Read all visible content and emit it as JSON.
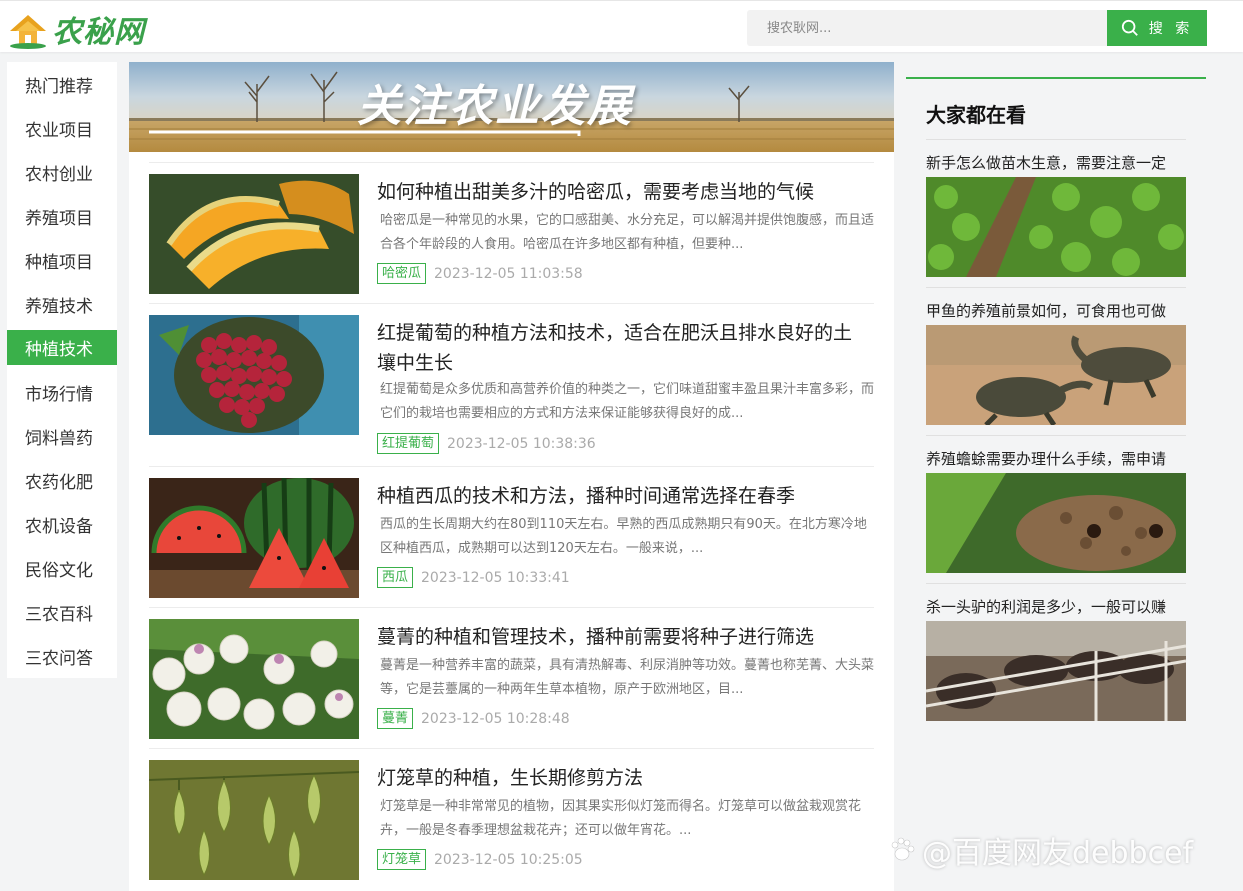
{
  "header": {
    "logo_text": "农秘网",
    "search_placeholder": "搜农耿网...",
    "search_button": "搜 索"
  },
  "sidebar": {
    "items": [
      {
        "label": "热门推荐"
      },
      {
        "label": "农业项目"
      },
      {
        "label": "农村创业"
      },
      {
        "label": "养殖项目"
      },
      {
        "label": "种植项目"
      },
      {
        "label": "养殖技术"
      },
      {
        "label": "种植技术",
        "active": true
      },
      {
        "label": "市场行情"
      },
      {
        "label": "饲料兽药"
      },
      {
        "label": "农药化肥"
      },
      {
        "label": "农机设备"
      },
      {
        "label": "民俗文化"
      },
      {
        "label": "三农百科"
      },
      {
        "label": "三农问答"
      }
    ]
  },
  "banner": {
    "title": "关注农业发展"
  },
  "articles": [
    {
      "title": "如何种植出甜美多汁的哈密瓜，需要考虑当地的气候",
      "desc": "哈密瓜是一种常见的水果，它的口感甜美、水分充足，可以解渴并提供饱腹感，而且适合各个年龄段的人食用。哈密瓜在许多地区都有种植，但要种...",
      "tag": "哈密瓜",
      "date": "2023-12-05 11:03:58",
      "image": "cantaloupe-image"
    },
    {
      "title": "红提葡萄的种植方法和技术，适合在肥沃且排水良好的土壤中生长",
      "desc": "红提葡萄是众多优质和高营养价值的种类之一，它们味道甜蜜丰盈且果汁丰富多彩，而它们的栽培也需要相应的方式和方法来保证能够获得良好的成...",
      "tag": "红提葡萄",
      "date": "2023-12-05 10:38:36",
      "image": "red-grape-image"
    },
    {
      "title": "种植西瓜的技术和方法，播种时间通常选择在春季",
      "desc": "西瓜的生长周期大约在80到110天左右。早熟的西瓜成熟期只有90天。在北方寒冷地区种植西瓜，成熟期可以达到120天左右。一般来说，...",
      "tag": "西瓜",
      "date": "2023-12-05 10:33:41",
      "image": "watermelon-image"
    },
    {
      "title": "蔓菁的种植和管理技术，播种前需要将种子进行筛选",
      "desc": "蔓菁是一种营养丰富的蔬菜，具有清热解毒、利尿消肿等功效。蔓菁也称芜菁、大头菜等，它是芸薹属的一种两年生草本植物，原产于欧洲地区，目...",
      "tag": "蔓菁",
      "date": "2023-12-05 10:28:48",
      "image": "turnip-image"
    },
    {
      "title": "灯笼草的种植，生长期修剪方法",
      "desc": "灯笼草是一种非常常见的植物，因其果实形似灯笼而得名。灯笼草可以做盆栽观赏花卉，一般是冬春季理想盆栽花卉；还可以做年宵花。...",
      "tag": "灯笼草",
      "date": "2023-12-05 10:25:05",
      "image": "physalis-image"
    }
  ],
  "right": {
    "title": "大家都在看",
    "items": [
      {
        "title": "新手怎么做苗木生意，需要注意一定",
        "image": "seedlings-image"
      },
      {
        "title": "甲鱼的养殖前景如何，可食用也可做",
        "image": "softshell-turtle-image"
      },
      {
        "title": "养殖蟾蜍需要办理什么手续，需申请",
        "image": "toad-image"
      },
      {
        "title": "杀一头驴的利润是多少，一般可以赚",
        "image": "donkey-image"
      }
    ]
  },
  "watermark": {
    "text": "@百度网友debbcef"
  },
  "colors": {
    "accent": "#3ab04a"
  }
}
